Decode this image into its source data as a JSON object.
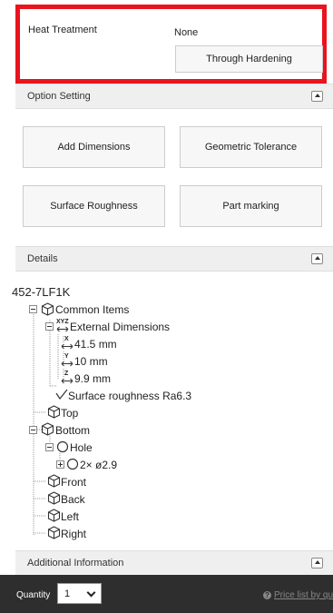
{
  "heat_treatment": {
    "label": "Heat Treatment",
    "value": "None",
    "button_label": "Through Hardening"
  },
  "option_setting": {
    "title": "Option Setting",
    "buttons": [
      "Add Dimensions",
      "Geometric Tolerance",
      "Surface Roughness",
      "Part marking"
    ]
  },
  "details": {
    "title": "Details",
    "part_number": "452-7LF1K",
    "tree": {
      "common_items": "Common Items",
      "external_dimensions": "External Dimensions",
      "dim_x_axis": "X",
      "dim_x": "41.5 mm",
      "dim_y_axis": "Y",
      "dim_y": "10 mm",
      "dim_z_axis": "Z",
      "dim_z": "9.9 mm",
      "xyz_glyph": "XYZ",
      "surface_roughness": "Surface roughness Ra6.3",
      "top": "Top",
      "bottom": "Bottom",
      "hole": "Hole",
      "hole_detail": "2× ø2.9",
      "front": "Front",
      "back": "Back",
      "left": "Left",
      "right": "Right"
    }
  },
  "additional_information": {
    "title": "Additional Information"
  },
  "footer": {
    "quantity_label": "Quantity",
    "quantity_value": "1",
    "price_list_link": "Price list by quanti",
    "help_glyph": "?"
  }
}
